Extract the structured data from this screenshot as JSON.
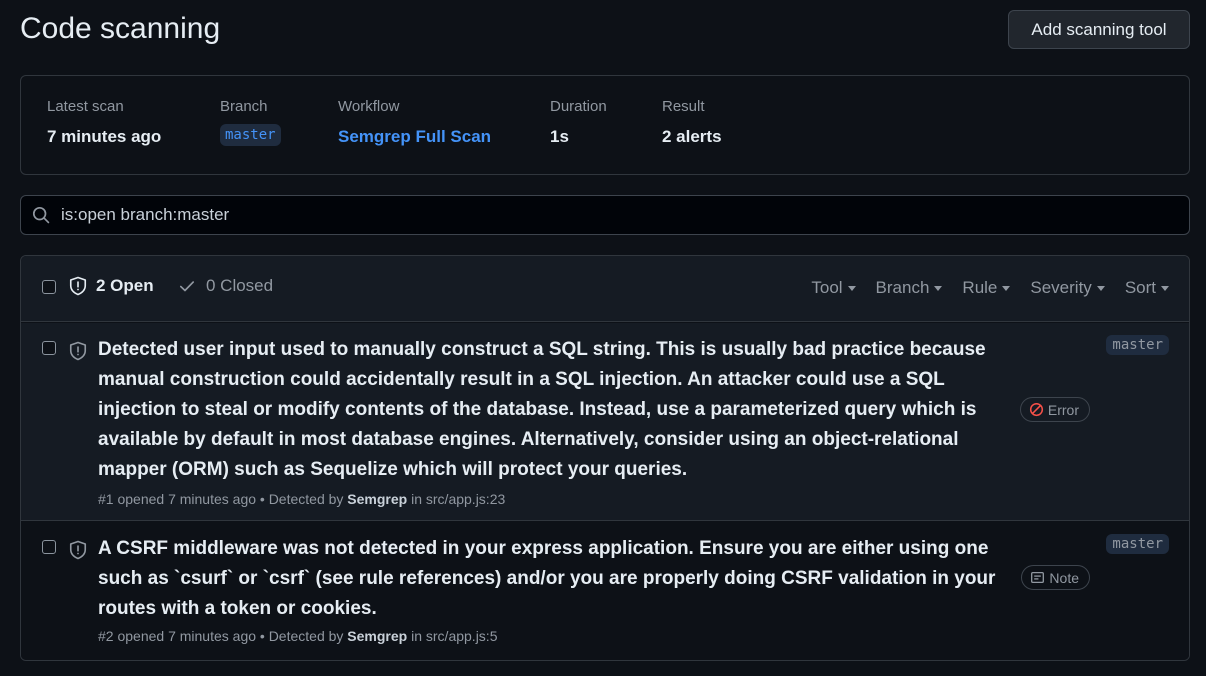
{
  "header": {
    "title": "Code scanning",
    "add_tool_label": "Add scanning tool"
  },
  "summary": {
    "latest_scan_label": "Latest scan",
    "latest_scan_value": "7 minutes ago",
    "branch_label": "Branch",
    "branch_value": "master",
    "workflow_label": "Workflow",
    "workflow_value": "Semgrep Full Scan",
    "duration_label": "Duration",
    "duration_value": "1s",
    "result_label": "Result",
    "result_value": "2 alerts"
  },
  "search": {
    "value": "is:open branch:master"
  },
  "alerts": {
    "open_label": "2 Open",
    "closed_label": "0 Closed",
    "filters": [
      "Tool",
      "Branch",
      "Rule",
      "Severity",
      "Sort"
    ],
    "items": [
      {
        "title": "Detected user input used to manually construct a SQL string. This is usually bad practice because manual construction could accidentally result in a SQL injection. An attacker could use a SQL injection to steal or modify contents of the database. Instead, use a parameterized query which is available by default in most database engines. Alternatively, consider using an object-relational mapper (ORM) such as Sequelize which will protect your queries.",
        "meta_prefix": "#1 opened 7 minutes ago • Detected by ",
        "tool": "Semgrep",
        "meta_suffix": " in src/app.js:23",
        "severity": "Error",
        "branch": "master"
      },
      {
        "title": "A CSRF middleware was not detected in your express application. Ensure you are either using one such as `csurf` or `csrf` (see rule references) and/or you are properly doing CSRF validation in your routes with a token or cookies.",
        "meta_prefix": "#2 opened 7 minutes ago • Detected by ",
        "tool": "Semgrep",
        "meta_suffix": " in src/app.js:5",
        "severity": "Note",
        "branch": "master"
      }
    ]
  },
  "colors": {
    "background": "#0d1117",
    "accent_link": "#4493f8",
    "muted_text": "#9198a1",
    "error_icon": "#f85149"
  }
}
